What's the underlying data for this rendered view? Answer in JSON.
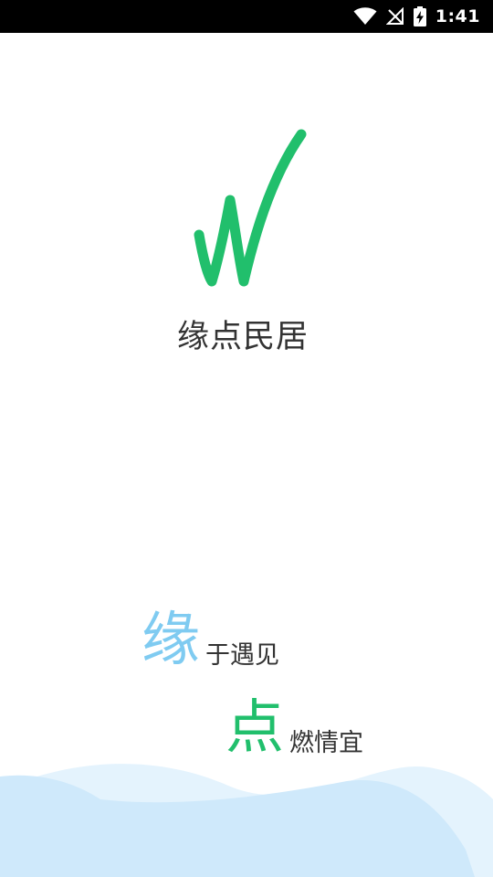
{
  "status_bar": {
    "time": "1:41",
    "icons": [
      "wifi-icon",
      "no-signal-icon",
      "battery-charging-icon"
    ]
  },
  "app": {
    "name": "缘点民居",
    "logo_color": "#21bf6c"
  },
  "slogan": {
    "line1_char": "缘",
    "line1_text": "于遇见",
    "line1_color": "#7fcbf1",
    "line2_char": "点",
    "line2_text": "燃情宜",
    "line2_color": "#21bf6c"
  },
  "colors": {
    "wave_back": "#e4f3fd",
    "wave_front": "#cfe9fb"
  }
}
